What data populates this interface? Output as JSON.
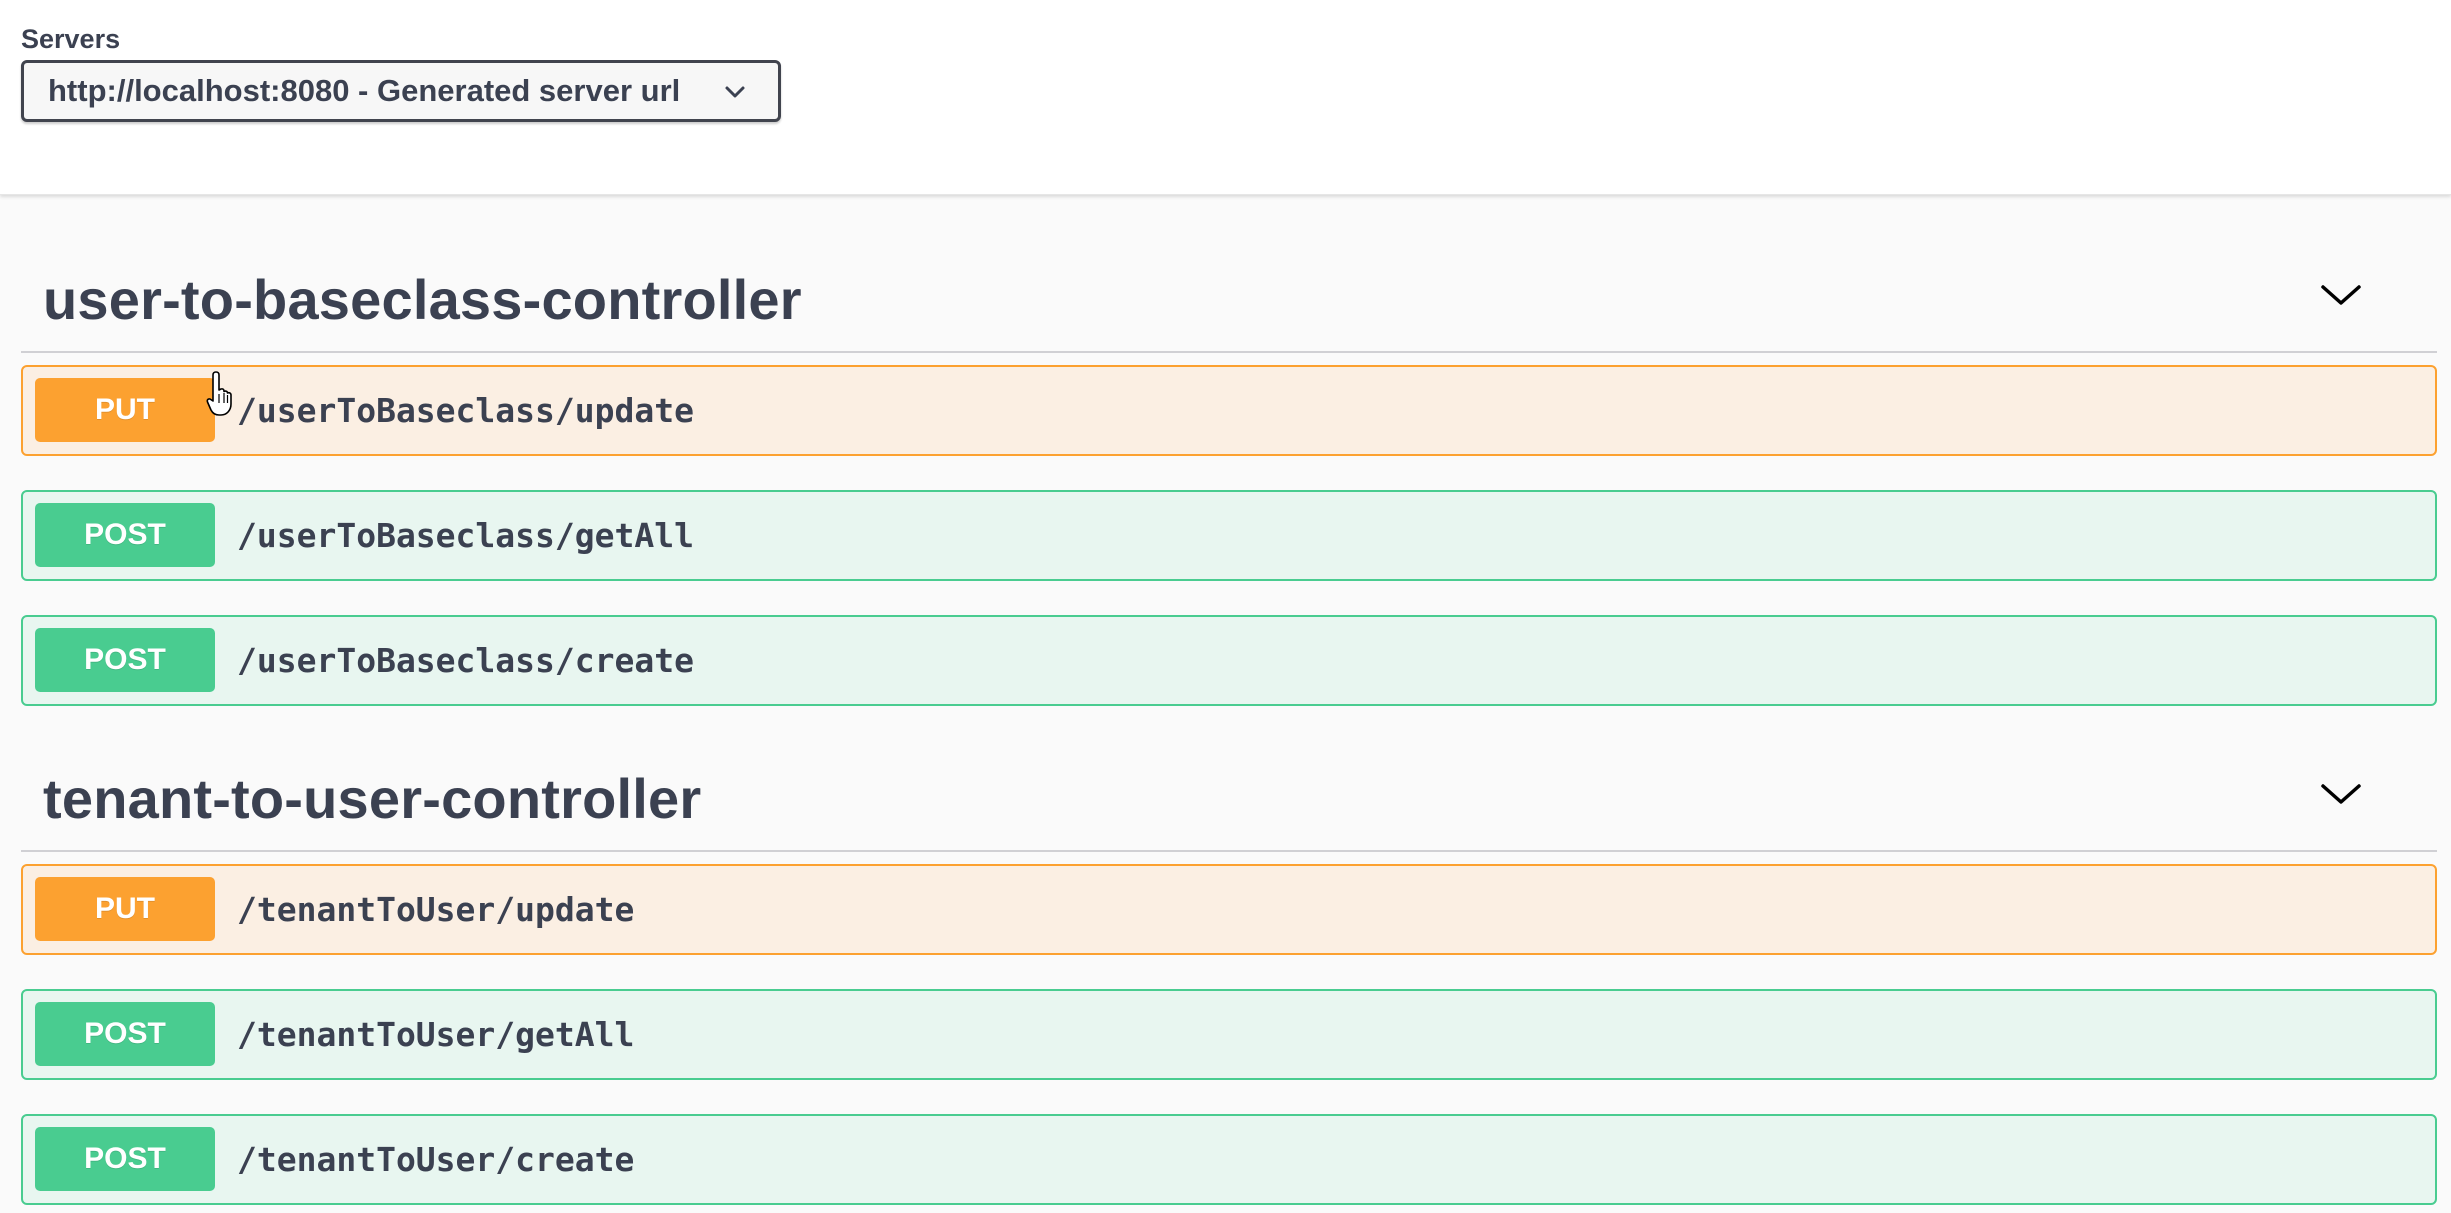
{
  "servers": {
    "label": "Servers",
    "selected": "http://localhost:8080 - Generated server url"
  },
  "sections": [
    {
      "title": "user-to-baseclass-controller",
      "operations": [
        {
          "method": "PUT",
          "path": "/userToBaseclass/update"
        },
        {
          "method": "POST",
          "path": "/userToBaseclass/getAll"
        },
        {
          "method": "POST",
          "path": "/userToBaseclass/create"
        }
      ]
    },
    {
      "title": "tenant-to-user-controller",
      "operations": [
        {
          "method": "PUT",
          "path": "/tenantToUser/update"
        },
        {
          "method": "POST",
          "path": "/tenantToUser/getAll"
        },
        {
          "method": "POST",
          "path": "/tenantToUser/create"
        }
      ]
    }
  ],
  "colors": {
    "put": "#fca130",
    "post": "#49cc90",
    "text": "#3b4151"
  },
  "icons": {
    "server_select_chevron": "chevron-down-icon",
    "section_toggle": "chevron-down-icon",
    "cursor": "hand-pointer-cursor-icon"
  }
}
